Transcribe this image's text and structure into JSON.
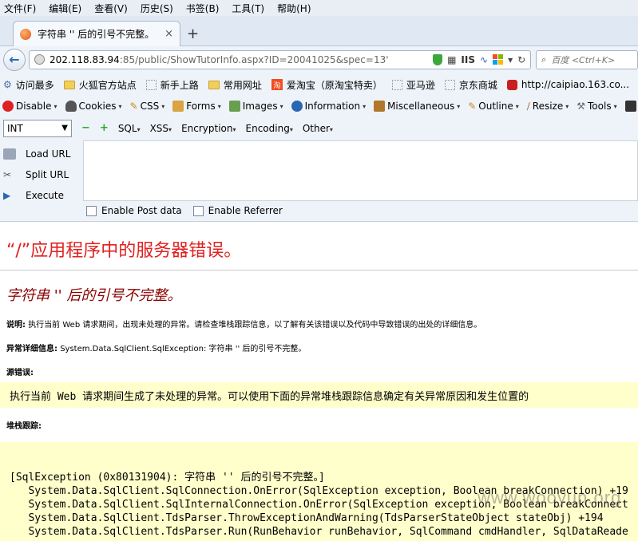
{
  "menu": [
    "文件(F)",
    "编辑(E)",
    "查看(V)",
    "历史(S)",
    "书签(B)",
    "工具(T)",
    "帮助(H)"
  ],
  "tab": {
    "title": "字符串 '' 后的引号不完整。",
    "close": "×",
    "new": "+"
  },
  "nav": {
    "url_host": "202.118.83.94",
    "url_path": ":85/public/ShowTutorInfo.aspx?ID=20041025&spec=13'",
    "url_icons": {
      "iis": "IIS"
    },
    "search_placeholder": "百度 <Ctrl+K>"
  },
  "bookmarks": [
    {
      "label": "访问最多",
      "icon": "gear-icon"
    },
    {
      "label": "火狐官方站点",
      "icon": "folder-icon"
    },
    {
      "label": "新手上路",
      "icon": "dotted-icon"
    },
    {
      "label": "常用网址",
      "icon": "folder-icon"
    },
    {
      "label": "爱淘宝（原淘宝特卖）",
      "icon": "taobao-icon"
    },
    {
      "label": "亚马逊",
      "icon": "dotted-icon"
    },
    {
      "label": "京东商城",
      "icon": "dotted-icon"
    },
    {
      "label": "http://caipiao.163.co...",
      "icon": "lottery-icon"
    }
  ],
  "webdev": [
    "Disable",
    "Cookies",
    "CSS",
    "Forms",
    "Images",
    "Information",
    "Miscellaneous",
    "Outline",
    "Resize",
    "Tools"
  ],
  "hackbar": {
    "select_value": "INT",
    "minus": "−",
    "plus": "+",
    "menus": [
      "SQL",
      "XSS",
      "Encryption",
      "Encoding",
      "Other"
    ],
    "actions": [
      "Load URL",
      "Split URL",
      "Execute"
    ],
    "checks": [
      "Enable Post data",
      "Enable Referrer"
    ]
  },
  "error": {
    "title": "“/”应用程序中的服务器错误。",
    "subtitle": "字符串 '' 后的引号不完整。",
    "desc_label": "说明:",
    "desc_text": "执行当前 Web 请求期间，出现未处理的异常。请检查堆栈跟踪信息，以了解有关该错误以及代码中导致错误的出处的详细信息。",
    "detail_label": "异常详细信息:",
    "detail_text": "System.Data.SqlClient.SqlException: 字符串 '' 后的引号不完整。",
    "source_label": "源错误:",
    "source_text": "执行当前 Web 请求期间生成了未处理的异常。可以使用下面的异常堆栈跟踪信息确定有关异常原因和发生位置的",
    "stack_label": "堆栈跟踪:",
    "stack_lines": [
      "[SqlException (0x80131904): 字符串 '' 后的引号不完整。]",
      "   System.Data.SqlClient.SqlConnection.OnError(SqlException exception, Boolean breakConnection) +19",
      "   System.Data.SqlClient.SqlInternalConnection.OnError(SqlException exception, Boolean breakConnect",
      "   System.Data.SqlClient.TdsParser.ThrowExceptionAndWarning(TdsParserStateObject stateObj) +194",
      "   System.Data.SqlClient.TdsParser.Run(RunBehavior runBehavior, SqlCommand cmdHandler, SqlDataReade"
    ]
  },
  "watermark": "www.wooyun.org",
  "colors": {
    "accent_red": "#e02020",
    "subtitle_red": "#8b0000",
    "code_bg": "#ffffcc"
  }
}
